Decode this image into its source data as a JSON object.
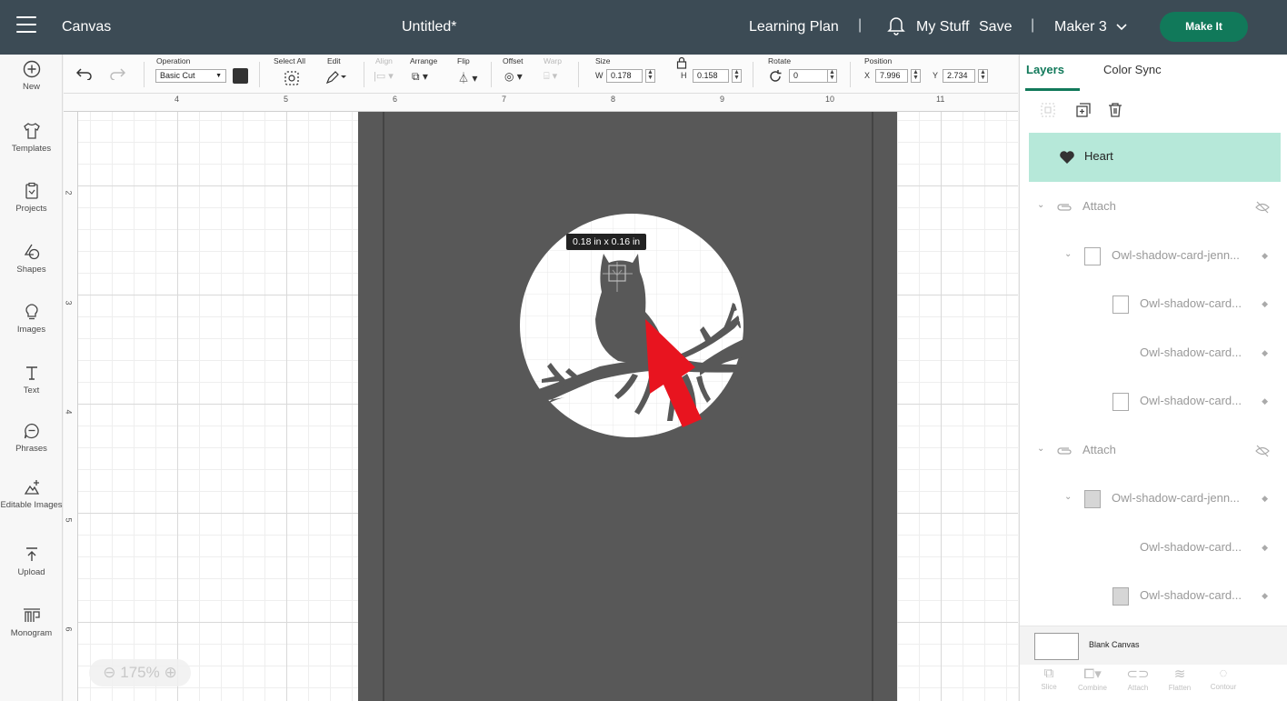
{
  "header": {
    "app_title": "Canvas",
    "doc_title": "Untitled*",
    "learning_plan": "Learning Plan",
    "separator": "|",
    "my_stuff": "My Stuff",
    "save": "Save",
    "machine": "Maker 3",
    "make_it": "Make It"
  },
  "sidebar": {
    "items": [
      {
        "label": "New",
        "icon": "plus-circle-icon"
      },
      {
        "label": "Templates",
        "icon": "shirt-icon"
      },
      {
        "label": "Projects",
        "icon": "clipboard-icon"
      },
      {
        "label": "Shapes",
        "icon": "shapes-icon"
      },
      {
        "label": "Images",
        "icon": "lightbulb-icon"
      },
      {
        "label": "Text",
        "icon": "text-icon"
      },
      {
        "label": "Phrases",
        "icon": "speech-bubble-icon"
      },
      {
        "label": "Editable Images",
        "icon": "editable-image-icon"
      },
      {
        "label": "Upload",
        "icon": "upload-icon"
      },
      {
        "label": "Monogram",
        "icon": "monogram-icon"
      }
    ]
  },
  "toolbar": {
    "operation_label": "Operation",
    "operation_value": "Basic Cut",
    "select_all": "Select All",
    "edit": "Edit",
    "align": "Align",
    "arrange": "Arrange",
    "flip": "Flip",
    "offset": "Offset",
    "warp": "Warp",
    "size_label": "Size",
    "w_label": "W",
    "w_value": "0.178",
    "h_label": "H",
    "h_value": "0.158",
    "rotate_label": "Rotate",
    "rotate_value": "0",
    "position_label": "Position",
    "x_label": "X",
    "x_value": "7.996",
    "y_label": "Y",
    "y_value": "2.734",
    "operation_color": "#333333"
  },
  "canvas": {
    "ruler_top": [
      "4",
      "5",
      "6",
      "7",
      "8",
      "9",
      "10",
      "11"
    ],
    "ruler_left": [
      "2",
      "3",
      "4",
      "5",
      "6"
    ],
    "size_tooltip": "0.18  in x 0.16  in",
    "zoom": "175%",
    "card_color": "#585858",
    "arrow_color": "#e8141f"
  },
  "panel": {
    "tabs": [
      "Layers",
      "Color Sync"
    ],
    "layers": {
      "selected": "Heart",
      "group1": "Attach",
      "g1_parent": "Owl-shadow-card-jenn...",
      "g1_child1": "Owl-shadow-card...",
      "g1_child2": "Owl-shadow-card...",
      "g1_child3": "Owl-shadow-card...",
      "group2": "Attach",
      "g2_parent": "Owl-shadow-card-jenn...",
      "g2_child1": "Owl-shadow-card...",
      "g2_child2": "Owl-shadow-card..."
    },
    "blank_canvas": "Blank Canvas",
    "tools": [
      "Slice",
      "Combine",
      "Attach",
      "Flatten",
      "Contour"
    ]
  }
}
